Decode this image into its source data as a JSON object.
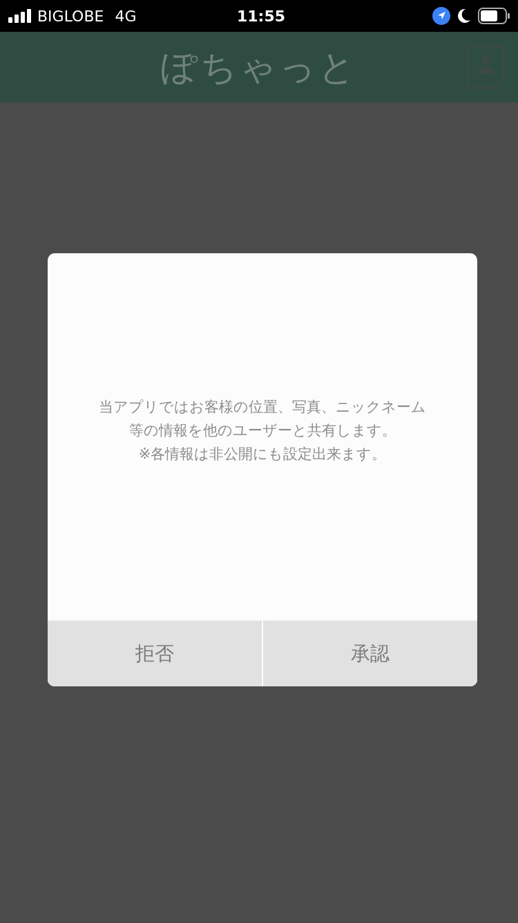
{
  "status_bar": {
    "carrier": "BIGLOBE",
    "network": "4G",
    "time": "11:55"
  },
  "header": {
    "title": "ぽちゃっと"
  },
  "dialog": {
    "message": "当アプリではお客様の位置、写真、ニックネーム等の情報を他のユーザーと共有します。",
    "note": "※各情報は非公開にも設定出来ます。",
    "buttons": [
      {
        "label": "拒否"
      },
      {
        "label": "承認"
      }
    ]
  }
}
